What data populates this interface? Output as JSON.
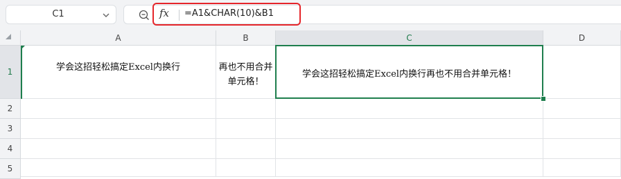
{
  "name_box": {
    "value": "C1"
  },
  "formula_bar": {
    "formula": "=A1&CHAR(10)&B1",
    "fx_label": "fx"
  },
  "columns": [
    "A",
    "B",
    "C",
    "D"
  ],
  "rows": [
    "1",
    "2",
    "3",
    "4",
    "5"
  ],
  "cells": {
    "A1": "学会这招轻松搞定Excel内换行",
    "B1_line1": "再也不用合并",
    "B1_line2": "单元格！",
    "C1": "学会这招轻松搞定Excel内换行再也不用合并单元格！"
  },
  "colors": {
    "selection": "#1e7e4d",
    "highlight_box": "#e5252a",
    "header_bg": "#f2f3f5"
  },
  "icons": [
    "chevron-down-icon",
    "zoom-icon",
    "fx-icon",
    "select-all-icon"
  ]
}
